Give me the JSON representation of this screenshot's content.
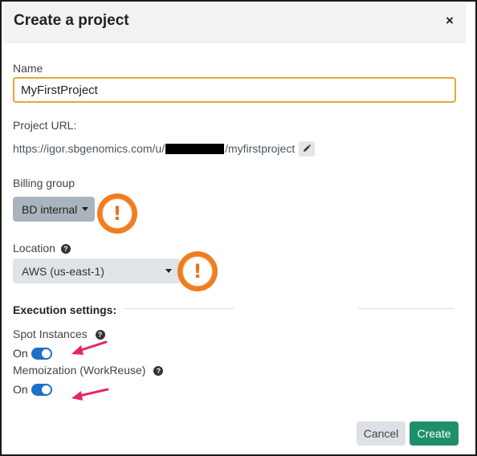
{
  "dialog": {
    "title": "Create a project",
    "close_icon": "×"
  },
  "name": {
    "label": "Name",
    "value": "MyFirstProject"
  },
  "project_url": {
    "label": "Project URL:",
    "prefix": "https://igor.sbgenomics.com/u/",
    "suffix": "/myfirstproject"
  },
  "billing": {
    "label": "Billing group",
    "selected": "BD internal"
  },
  "location": {
    "label": "Location",
    "selected": "AWS (us-east-1)"
  },
  "execution": {
    "title": "Execution settings:",
    "spot_label": "Spot Instances",
    "spot_state": "On",
    "memo_label": "Memoization (WorkReuse)",
    "memo_state": "On"
  },
  "warning_mark": "!",
  "help_mark": "?",
  "actions": {
    "cancel": "Cancel",
    "create": "Create"
  },
  "colors": {
    "accent_orange": "#f07d20",
    "annotation_arrow": "#e8265e",
    "toggle_on": "#1e6fc9",
    "primary_button": "#1e8f6a"
  }
}
